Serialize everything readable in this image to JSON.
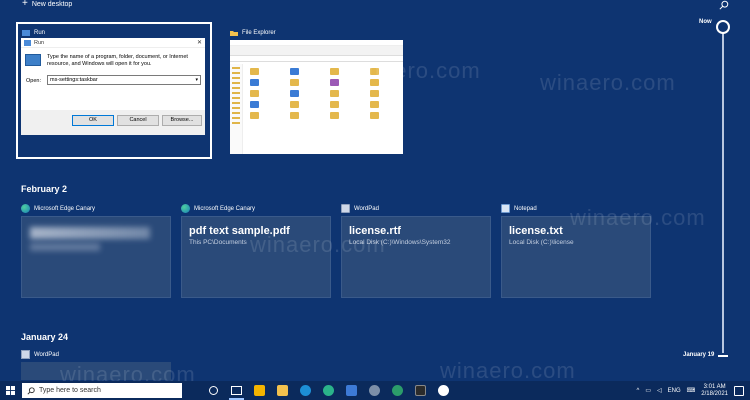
{
  "header": {
    "new_desktop_label": "New desktop"
  },
  "timeline": {
    "now_label": "Now",
    "january_label": "January 19"
  },
  "windows": [
    {
      "title": "Run",
      "icon": "run-icon"
    },
    {
      "title": "File Explorer",
      "icon": "folder-icon"
    }
  ],
  "run_dialog": {
    "title": "Run",
    "description": "Type the name of a program, folder, document, or Internet resource, and Windows will open it for you.",
    "open_label": "Open:",
    "field_value": "ms-settings:taskbar",
    "ok_label": "OK",
    "cancel_label": "Cancel",
    "browse_label": "Browse..."
  },
  "sections": {
    "february": "February 2",
    "january": "January 24"
  },
  "cards": [
    {
      "app": "Microsoft Edge Canary",
      "title": "",
      "subtitle": "",
      "icon": "edge-canary-icon"
    },
    {
      "app": "Microsoft Edge Canary",
      "title": "pdf text sample.pdf",
      "subtitle": "This PC\\Documents",
      "icon": "edge-canary-icon"
    },
    {
      "app": "WordPad",
      "title": "license.rtf",
      "subtitle": "Local Disk (C:)\\Windows\\System32",
      "icon": "wordpad-icon"
    },
    {
      "app": "Notepad",
      "title": "license.txt",
      "subtitle": "Local Disk (C:)\\license",
      "icon": "notepad-icon"
    }
  ],
  "january_item": {
    "app": "WordPad"
  },
  "watermark": "winaero.com",
  "taskbar": {
    "search_placeholder": "Type here to search",
    "language": "ENG",
    "time": "3:01 AM",
    "date": "2/18/2021"
  },
  "colors": {
    "background": "#0e3471",
    "card": "#2a4a79",
    "taskbar": "#0b2a5c"
  }
}
